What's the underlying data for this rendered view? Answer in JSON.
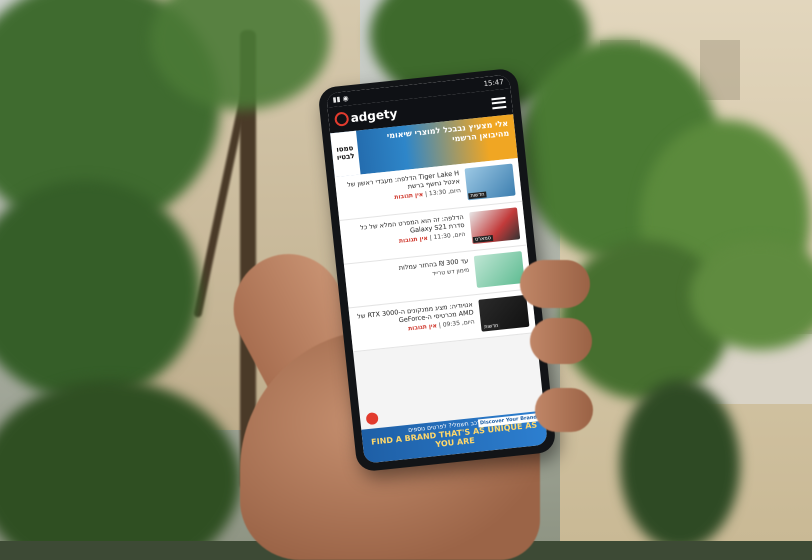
{
  "status_bar": {
    "time": "15:47"
  },
  "app": {
    "logo_text": "adgety",
    "menu_icon": "hamburger-menu-icon"
  },
  "banner": {
    "side_text": "סמסו לבטיו",
    "headline": "אלי מצעיץ נבבכל למוצרי שיאומי מהיבואן הרשמי"
  },
  "feed": [
    {
      "title": "Tiger Lake H הדלפה: מעבדי ראשון של אינטל נחשף ברשת",
      "time": "היום, 13:30",
      "comments": "אין תגובות",
      "tag": "חדשות",
      "thumb_color": "#6fa6c9"
    },
    {
      "title": "הדלפה: זה הוא המפרט המלא של כל סדרת Galaxy S21",
      "time": "היום, 11:30",
      "comments": "אין תגובות",
      "tag": "סמארט",
      "thumb_color": "#c23a3a"
    },
    {
      "title": "עד 300 ₪ בהחזר עמלות",
      "time": "מימון דש טרייד",
      "comments": "",
      "tag": "",
      "thumb_color": "#7dc8a6"
    },
    {
      "title": "אנויודיה: מציג ממנקונים ה-RTX 3000 של AMD מכרטיסי ה-GeForce",
      "time": "היום, 09:35",
      "comments": "אין תגובות",
      "tag": "חדשות",
      "thumb_color": "#1d1d1d"
    }
  ],
  "promo": {
    "line1": "רכישת רכב חשמלי? לפרטים נוספים",
    "line2": "FIND A BRAND THAT'S AS UNIQUE AS YOU ARE",
    "brand": "Discover Your Brand"
  }
}
